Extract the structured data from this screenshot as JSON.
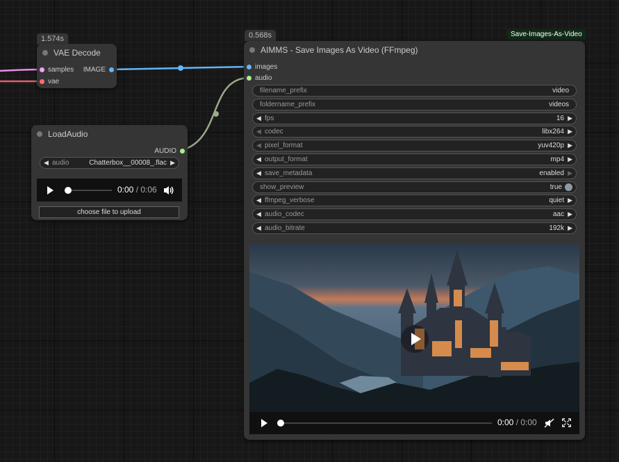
{
  "vae_decode": {
    "time": "1.574s",
    "title": "VAE Decode",
    "inputs": [
      {
        "label": "samples",
        "color": "#ff9cf9"
      },
      {
        "label": "vae",
        "color": "#ff6e6e"
      }
    ],
    "output": {
      "label": "IMAGE",
      "color": "#64b5f6"
    }
  },
  "load_audio": {
    "title": "LoadAudio",
    "output": {
      "label": "AUDIO",
      "color": "#a8f08c"
    },
    "audio_widget": {
      "name": "audio",
      "value": "Chatterbox__00008_.flac"
    },
    "player": {
      "current": "0:00",
      "sep": " / ",
      "duration": "0:06",
      "progress": 0
    },
    "upload_label": "choose file to upload"
  },
  "save_video": {
    "time": "0.568s",
    "badge": "Save-Images-As-Video",
    "title": "AIMMS - Save Images As Video (FFmpeg)",
    "inputs": [
      {
        "label": "images",
        "color": "#64b5f6"
      },
      {
        "label": "audio",
        "color": "#a8f08c"
      }
    ],
    "widgets": [
      {
        "name": "filename_prefix",
        "value": "video",
        "kind": "text"
      },
      {
        "name": "foldername_prefix",
        "value": "videos",
        "kind": "text"
      },
      {
        "name": "fps",
        "value": "16",
        "kind": "number"
      },
      {
        "name": "codec",
        "value": "libx264",
        "kind": "combo"
      },
      {
        "name": "pixel_format",
        "value": "yuv420p",
        "kind": "combo"
      },
      {
        "name": "output_format",
        "value": "mp4",
        "kind": "combo"
      },
      {
        "name": "save_metadata",
        "value": "enabled",
        "kind": "combo"
      },
      {
        "name": "show_preview",
        "value": "true",
        "kind": "toggle"
      },
      {
        "name": "ffmpeg_verbose",
        "value": "quiet",
        "kind": "combo"
      },
      {
        "name": "audio_codec",
        "value": "aac",
        "kind": "combo"
      },
      {
        "name": "audio_bitrate",
        "value": "192k",
        "kind": "combo"
      }
    ],
    "player": {
      "current": "0:00",
      "sep": " / ",
      "duration": "0:00",
      "progress": 0
    }
  },
  "icons": {
    "play": "play-icon",
    "volume": "volume-icon",
    "muted": "muted-icon",
    "fullscreen": "fullscreen-icon"
  }
}
